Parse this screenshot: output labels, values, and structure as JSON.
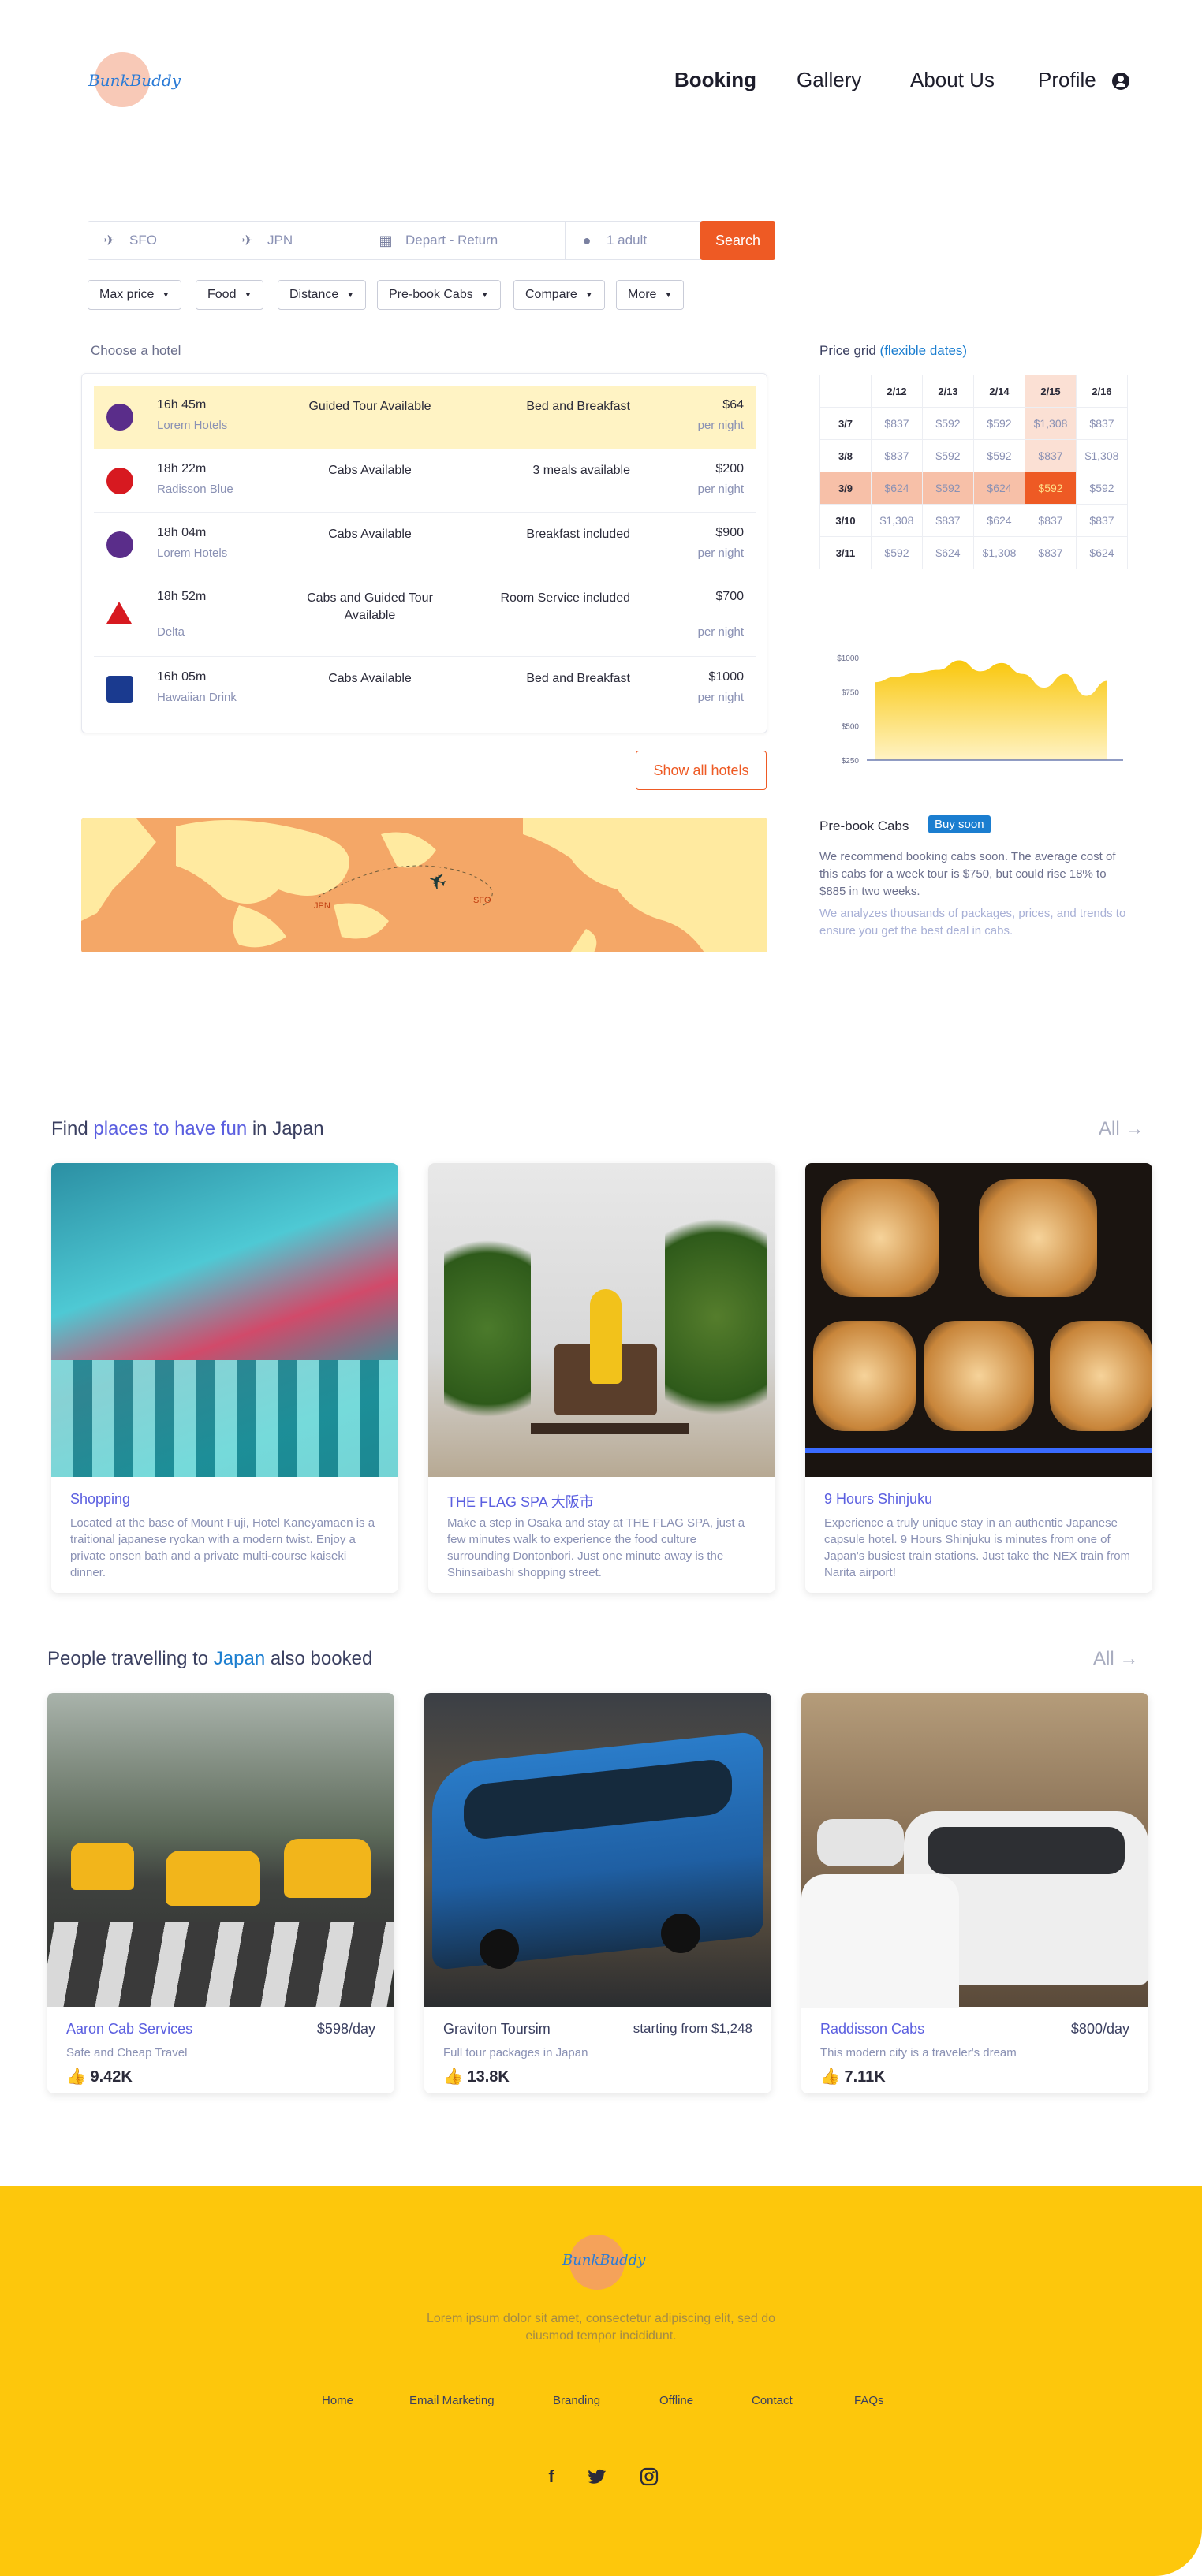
{
  "brand": {
    "name": "BunkBuddy"
  },
  "nav": {
    "booking": "Booking",
    "gallery": "Gallery",
    "about": "About Us",
    "profile": "Profile"
  },
  "search": {
    "from": "SFO",
    "to": "JPN",
    "dates": "Depart - Return",
    "travelers": "1 adult",
    "button": "Search"
  },
  "filters": [
    "Max price",
    "Food",
    "Distance",
    "Pre-book Cabs",
    "Compare",
    "More"
  ],
  "hotels_label": "Choose a hotel",
  "hotels": [
    {
      "duration": "16h 45m",
      "name": "Lorem Hotels",
      "service": "Guided Tour Available",
      "meal": "Bed and Breakfast",
      "price": "$64",
      "per": "per night",
      "icon": "hawaiian-logo",
      "color": "#5a2d8a"
    },
    {
      "duration": "18h 22m",
      "name": "Radisson Blue",
      "service": "Cabs Available",
      "meal": "3 meals available",
      "price": "$200",
      "per": "per night",
      "icon": "jal-logo",
      "color": "#d71920"
    },
    {
      "duration": "18h 04m",
      "name": "Lorem Hotels",
      "service": "Cabs Available",
      "meal": "Breakfast included",
      "price": "$900",
      "per": "per night",
      "icon": "hawaiian-logo",
      "color": "#5a2d8a"
    },
    {
      "duration": "18h 52m",
      "name": "Delta",
      "service": "Cabs and Guided Tour Available",
      "meal": "Room Service included",
      "price": "$700",
      "per": "per night",
      "icon": "delta-logo",
      "color": "#d71920"
    },
    {
      "duration": "16h 05m",
      "name": "Hawaiian Drink",
      "service": "Cabs Available",
      "meal": "Bed and Breakfast",
      "price": "$1000",
      "per": "per night",
      "icon": "united-logo",
      "color": "#1a3a8f"
    }
  ],
  "show_all": "Show all hotels",
  "map": {
    "from": "JPN",
    "to": "SFO"
  },
  "price_grid": {
    "title": "Price grid",
    "title_accent": "(flexible dates)",
    "columns": [
      "2/12",
      "2/13",
      "2/14",
      "2/15",
      "2/16"
    ],
    "rows": [
      {
        "date": "3/7",
        "values": [
          "$837",
          "$592",
          "$592",
          "$1,308",
          "$837"
        ]
      },
      {
        "date": "3/8",
        "values": [
          "$837",
          "$592",
          "$592",
          "$837",
          "$1,308"
        ]
      },
      {
        "date": "3/9",
        "values": [
          "$624",
          "$592",
          "$624",
          "$592",
          "$592"
        ]
      },
      {
        "date": "3/10",
        "values": [
          "$1,308",
          "$837",
          "$624",
          "$837",
          "$837"
        ]
      },
      {
        "date": "3/11",
        "values": [
          "$592",
          "$624",
          "$1,308",
          "$837",
          "$624"
        ]
      }
    ]
  },
  "chart_data": {
    "type": "area",
    "y_ticks": [
      "$1000",
      "$750",
      "$500",
      "$250"
    ],
    "ylim": [
      250,
      1000
    ],
    "values": [
      820,
      860,
      890,
      910,
      980,
      900,
      960,
      880,
      780,
      880,
      720,
      830
    ]
  },
  "cabs": {
    "title": "Pre-book Cabs",
    "badge": "Buy soon",
    "text": "We recommend booking cabs soon. The average cost of this cabs for a week tour is $750, but could rise 18% to $885 in two weeks.",
    "note": "We analyzes thousands of packages, prices, and trends to ensure you get the best deal in cabs."
  },
  "fun": {
    "title_pre": "Find ",
    "title_accent": "places to have fun",
    "title_post": " in Japan",
    "all": "All",
    "cards": [
      {
        "title": "Shopping",
        "desc": "Located at the base of Mount Fuji, Hotel Kaneyamaen is a traitional japanese ryokan with a modern twist. Enjoy a private onsen bath and a private multi-course kaiseki dinner."
      },
      {
        "title": "THE FLAG SPA 大阪市",
        "desc": "Make a step in Osaka and stay at THE FLAG SPA, just a few minutes walk to experience the food culture surrounding Dontonbori. Just one minute away is the Shinsaibashi shopping street."
      },
      {
        "title": "9 Hours Shinjuku",
        "desc": "Experience a truly unique stay in an authentic Japanese capsule hotel. 9 Hours Shinjuku is minutes from one of Japan's busiest train stations. Just take the NEX train from Narita airport!"
      }
    ]
  },
  "booked": {
    "title_pre": "People travelling to ",
    "title_accent": "Japan",
    "title_post": " also booked",
    "all": "All",
    "cards": [
      {
        "title": "Aaron Cab Services",
        "price": "$598/day",
        "desc": "Safe and Cheap Travel",
        "likes": "9.42K"
      },
      {
        "title": "Graviton Toursim",
        "price": "starting from $1,248",
        "desc": "Full tour packages in Japan",
        "likes": "13.8K"
      },
      {
        "title": "Raddisson Cabs",
        "price": "$800/day",
        "desc": "This modern city is a traveler's dream",
        "likes": "7.11K"
      }
    ]
  },
  "footer": {
    "text": "Lorem ipsum dolor sit amet, consectetur adipiscing elit, sed do eiusmod tempor incididunt.",
    "links": [
      "Home",
      "Email Marketing",
      "Branding",
      "Offline",
      "Contact",
      "FAQs"
    ]
  },
  "colors": {
    "accent": "#ee5a24",
    "purple": "#5b5fe0",
    "blue": "#1b7ed0",
    "footer": "#fdc70c"
  }
}
